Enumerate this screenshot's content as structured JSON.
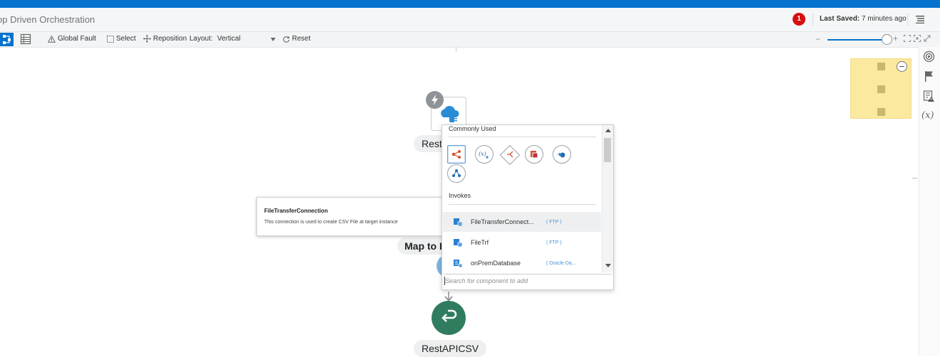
{
  "header": {
    "app_title": "op Driven Orchestration",
    "error_count": "1",
    "last_saved_label": "Last Saved:",
    "last_saved_value": "7 minutes ago",
    "accent_color": "#0572ce",
    "error_color": "#d80f0f"
  },
  "toolbar": {
    "global_fault": "Global Fault",
    "select": "Select",
    "reposition": "Reposition",
    "layout_label": "Layout:",
    "layout_value": "Vertical",
    "reset": "Reset"
  },
  "canvas": {
    "trigger_label": "Rest",
    "map_label": "Map to I",
    "end_label": "RestAPICSV",
    "end_node_color": "#2f7d5e"
  },
  "tooltip": {
    "title": "FileTransferConnection",
    "description": "This connection is used to create CSV File at target instance"
  },
  "popover": {
    "commonly_used_title": "Commonly Used",
    "invokes_title": "Invokes",
    "actions": [
      "map-icon",
      "assign-icon",
      "switch-icon",
      "stage-file-icon",
      "for-each-icon",
      "notification-icon"
    ],
    "invokes": [
      {
        "name": "FileTransferConnect...",
        "type": "( FTP )"
      },
      {
        "name": "FileTrf",
        "type": "( FTP )"
      },
      {
        "name": "onPremDatabase",
        "type": "( Oracle Da..."
      }
    ],
    "search_placeholder": "Search for component to add"
  },
  "right_panel": {
    "icons": [
      "target-icon",
      "flag-icon",
      "list-alert-icon",
      "variable-icon"
    ],
    "variable_glyph": "(x)"
  }
}
